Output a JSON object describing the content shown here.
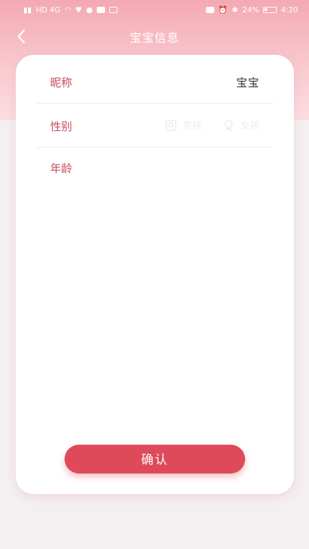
{
  "status_bar": {
    "carrier_left": "HD 4G",
    "time": "4:20",
    "battery": "24%"
  },
  "header": {
    "title": "宝宝信息"
  },
  "form": {
    "nickname_label": "昵称",
    "nickname_value": "宝宝",
    "gender_label": "性别",
    "gender_options": [
      {
        "label": "男孩",
        "icon": "boy-icon"
      },
      {
        "label": "女孩",
        "icon": "girl-icon"
      }
    ],
    "age_label": "年龄"
  },
  "confirm_label": "确认",
  "colors": {
    "accent": "#df4a5b",
    "label": "#c94a5a",
    "header_top": "#f4a9b3"
  }
}
